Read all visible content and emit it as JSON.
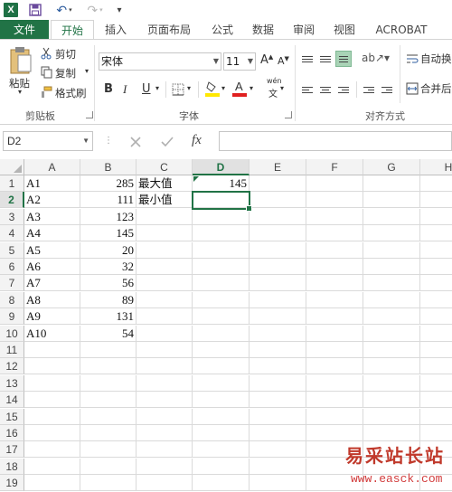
{
  "app": {
    "logo": "X"
  },
  "tabs": [
    "文件",
    "开始",
    "插入",
    "页面布局",
    "公式",
    "数据",
    "审阅",
    "视图",
    "ACROBAT"
  ],
  "ribbon": {
    "clipboard": {
      "paste": "粘贴",
      "cut": "剪切",
      "copy": "复制",
      "format_painter": "格式刷",
      "group_label": "剪贴板"
    },
    "font": {
      "name": "宋体",
      "size": "11",
      "bold": "B",
      "italic": "I",
      "underline": "U",
      "phonetic": "wén",
      "group_label": "字体"
    },
    "alignment": {
      "wrap_text": "自动换",
      "merge_center": "合并后",
      "group_label": "对齐方式"
    }
  },
  "formula_bar": {
    "name_box": "D2",
    "fx": "fx",
    "value": ""
  },
  "columns": [
    "A",
    "B",
    "C",
    "D",
    "E",
    "F",
    "G",
    "H"
  ],
  "selected_column": "D",
  "selected_row": 2,
  "rows": [
    {
      "n": "1",
      "A": "A1",
      "B": "285",
      "C": "最大值",
      "D": "145"
    },
    {
      "n": "2",
      "A": "A2",
      "B": "111",
      "C": "最小值",
      "D": ""
    },
    {
      "n": "3",
      "A": "A3",
      "B": "123",
      "C": "",
      "D": ""
    },
    {
      "n": "4",
      "A": "A4",
      "B": "145",
      "C": "",
      "D": ""
    },
    {
      "n": "5",
      "A": "A5",
      "B": "20",
      "C": "",
      "D": ""
    },
    {
      "n": "6",
      "A": "A6",
      "B": "32",
      "C": "",
      "D": ""
    },
    {
      "n": "7",
      "A": "A7",
      "B": "56",
      "C": "",
      "D": ""
    },
    {
      "n": "8",
      "A": "A8",
      "B": "89",
      "C": "",
      "D": ""
    },
    {
      "n": "9",
      "A": "A9",
      "B": "131",
      "C": "",
      "D": ""
    },
    {
      "n": "10",
      "A": "A10",
      "B": "54",
      "C": "",
      "D": ""
    },
    {
      "n": "11"
    },
    {
      "n": "12"
    },
    {
      "n": "13"
    },
    {
      "n": "14"
    },
    {
      "n": "15"
    },
    {
      "n": "16"
    },
    {
      "n": "17"
    },
    {
      "n": "18"
    },
    {
      "n": "19"
    }
  ],
  "watermark": {
    "text": "易采站长站",
    "url": "www.easck.com"
  },
  "colors": {
    "accent": "#217346",
    "file_tab": "#217346",
    "font_color": "#e02020",
    "highlight": "#ffe800"
  }
}
